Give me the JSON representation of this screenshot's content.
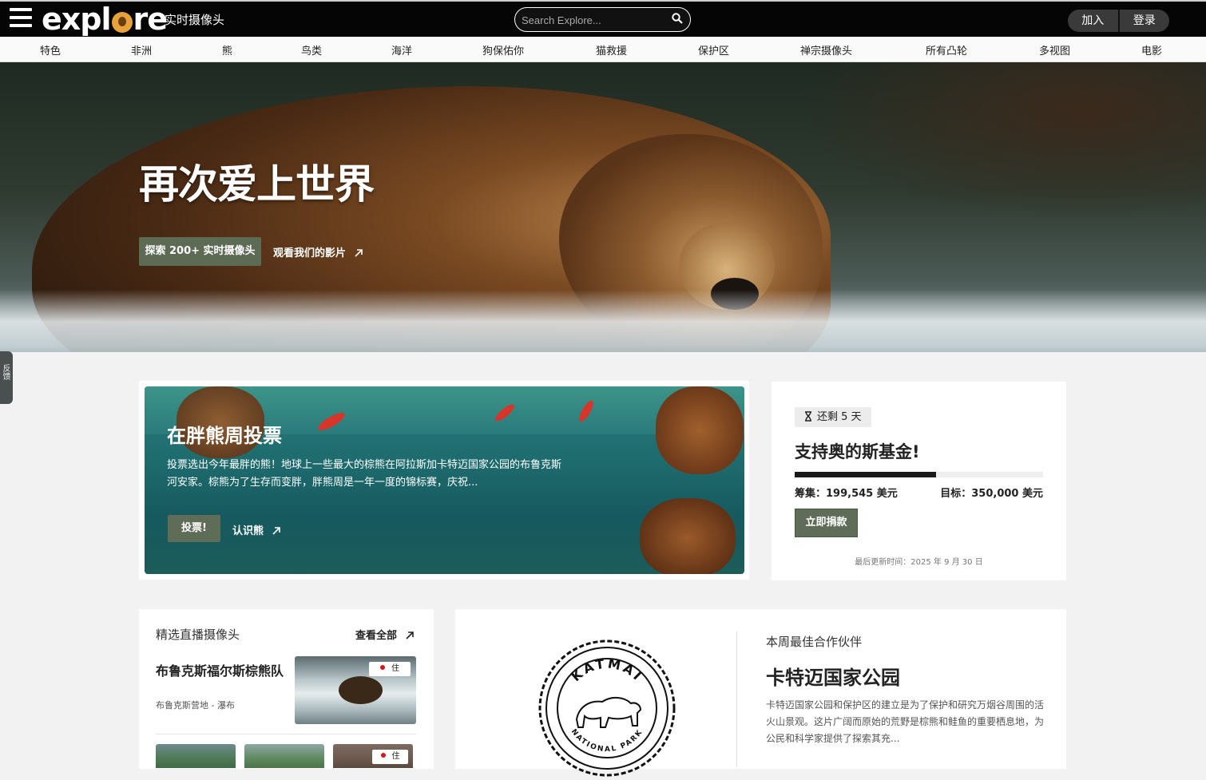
{
  "header": {
    "logo_text": "explore",
    "subtitle": "实时摄像头",
    "search_placeholder": "Search Explore...",
    "join_label": "加入",
    "login_label": "登录"
  },
  "categories": [
    "特色",
    "非洲",
    "熊",
    "鸟类",
    "海洋",
    "狗保佑你",
    "猫救援",
    "保护区",
    "禅宗摄像头",
    "所有凸轮",
    "多视图",
    "电影"
  ],
  "hero": {
    "title": "再次爱上世界",
    "cta_label": "探索 200+ 实时摄像头",
    "film_label": "观看我们的影片"
  },
  "side_tab": {
    "label": "反馈"
  },
  "vote": {
    "title": "在胖熊周投票",
    "description": "投票选出今年最胖的熊！地球上一些最大的棕熊在阿拉斯加卡特迈国家公园的布鲁克斯河安家。棕熊为了生存而变胖，胖熊周是一年一度的锦标赛，庆祝...",
    "vote_label": "投票!",
    "learn_label": "认识熊"
  },
  "fund": {
    "days_left": "还剩 5 天",
    "title": "支持奥的斯基金!",
    "progress": 0.57,
    "raised": "筹集：199,545 美元",
    "goal": "目标：350,000 美元",
    "donate_label": "立即捐款",
    "updated": "最后更新时间：2025 年 9 月 30 日"
  },
  "featured_cams": {
    "heading": "精选直播摄像头",
    "view_all": "查看全部",
    "main_cam": {
      "name": "布鲁克斯福尔斯棕熊队",
      "location": "布鲁克斯营地 - 瀑布",
      "live_badge": "住"
    },
    "more_badge": "住"
  },
  "partner": {
    "kicker": "本周最佳合作伙伴",
    "name": "卡特迈国家公园",
    "description": "卡特迈国家公园和保护区的建立是为了保护和研究万烟谷周围的活火山景观。这片广阔而原始的荒野是棕熊和鲑鱼的重要栖息地，为公民和科学家提供了探索其充...",
    "seal_top": "KATMAI",
    "seal_bottom": "NATIONAL PARK"
  },
  "colors": {
    "button_green": "#5d6b55",
    "topbar": "#050505",
    "vote_bg": "#1e6b6e"
  }
}
